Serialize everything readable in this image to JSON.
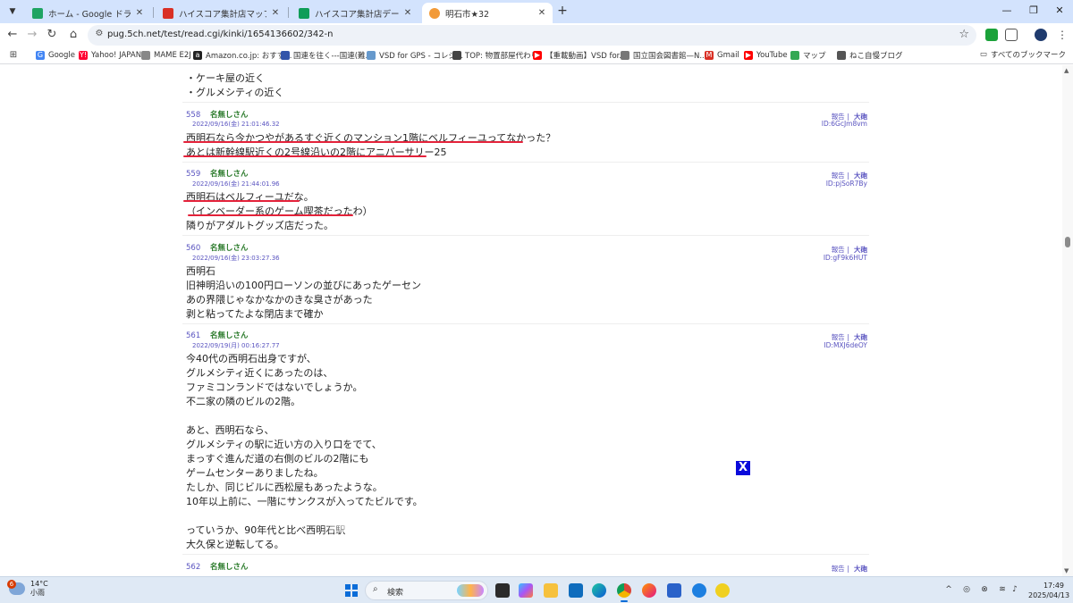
{
  "tabs": [
    {
      "label": "ホーム - Google ドライブ",
      "color": "#1fa463"
    },
    {
      "label": "ハイスコア集計店マップ（ゲーメスト）",
      "color": "#d93025"
    },
    {
      "label": "ハイスコア集計店データベース - Goo",
      "color": "#0f9d58"
    },
    {
      "label": "明石市★32",
      "color": "#f29a38",
      "active": true
    }
  ],
  "toolbar": {
    "url": "pug.5ch.net/test/read.cgi/kinki/1654136602/342-n"
  },
  "bookmarks": [
    {
      "label": "Google",
      "color": "#4285f4",
      "glyph": "G"
    },
    {
      "label": "Yahoo! JAPAN",
      "color": "#ff0033",
      "glyph": "Y!"
    },
    {
      "label": "MAME E2J",
      "color": "#888888",
      "glyph": ""
    },
    {
      "label": "Amazon.co.jp: おすす...",
      "color": "#222222",
      "glyph": "a"
    },
    {
      "label": "国連を往く---国連(難...",
      "color": "#3355aa",
      "glyph": ""
    },
    {
      "label": "VSD for GPS - コレジ...",
      "color": "#6699cc",
      "glyph": ""
    },
    {
      "label": "TOP: 物置部屋代わり",
      "color": "#444444",
      "glyph": ""
    },
    {
      "label": "【重載動画】VSD for...",
      "color": "#ff0000",
      "glyph": "▶"
    },
    {
      "label": "国立国会図書館—N...",
      "color": "#777777",
      "glyph": ""
    },
    {
      "label": "Gmail",
      "color": "#d93025",
      "glyph": "M"
    },
    {
      "label": "YouTube",
      "color": "#ff0000",
      "glyph": "▶"
    },
    {
      "label": "マップ",
      "color": "#34a853",
      "glyph": ""
    },
    {
      "label": "ねこ自慢ブログ",
      "color": "#555555",
      "glyph": ""
    }
  ],
  "bookmarks_all": "すべてのブックマーク",
  "top_lines": [
    "・ケーキ屋の近く",
    "・グルメシティの近く"
  ],
  "posts": [
    {
      "no": "558",
      "name": "名無しさん",
      "date": "2022/09/16(金) 21:01:46.32",
      "report": "報告",
      "sep": "|",
      "big": "大砲",
      "id": "ID:6GcJm8vm",
      "lines": [
        "西明石なら今かつやがあるすぐ近くのマンション1階にベルフィーユってなかった？",
        "あとは新幹線駅近くの2号線沿いの2階にアニバーサリー25"
      ]
    },
    {
      "no": "559",
      "name": "名無しさん",
      "date": "2022/09/16(金) 21:44:01.96",
      "report": "報告",
      "sep": "|",
      "big": "大砲",
      "id": "ID:pjSoR7By",
      "lines": [
        "西明石はベルフィーユだな。",
        "（インベーダー系のゲーム喫茶だったわ）",
        "隣りがアダルトグッズ店だった。"
      ]
    },
    {
      "no": "560",
      "name": "名無しさん",
      "date": "2022/09/16(金) 23:03:27.36",
      "report": "報告",
      "sep": "|",
      "big": "大砲",
      "id": "ID:gF9k6HUT",
      "lines": [
        "西明石",
        "旧神明沿いの100円ローソンの並びにあったゲーセン",
        "あの界隈じゃなかなかのきな臭さがあった",
        "剥と粘ってたよな閉店まで確か"
      ]
    },
    {
      "no": "561",
      "name": "名無しさん",
      "date": "2022/09/19(月) 00:16:27.77",
      "report": "報告",
      "sep": "|",
      "big": "大砲",
      "id": "ID:MXJ6deOY",
      "lines": [
        "今40代の西明石出身ですが、",
        "グルメシティ近くにあったのは、",
        "ファミコンランドではないでしょうか。",
        "不二家の隣のビルの2階。",
        "",
        "あと、西明石なら、",
        "グルメシティの駅に近い方の入り口をでて、",
        "まっすぐ進んだ道の右側のビルの2階にも",
        "ゲームセンターありましたね。",
        "たしか、同じビルに西松屋もあったような。",
        "10年以上前に、一階にサンクスが入ってたビルです。",
        "",
        "っていうか、90年代と比べ西明石駅",
        "大久保と逆転してる。"
      ]
    },
    {
      "no": "562",
      "name": "名無しさん",
      "date": "",
      "report": "報告",
      "sep": "|",
      "big": "大砲",
      "id": ""
    }
  ],
  "close_button": "X",
  "taskbar": {
    "weather_temp": "14°C",
    "weather_desc": "小雨",
    "weather_badge": "6",
    "search_placeholder": "検索",
    "time": "17:49",
    "date": "2025/04/13"
  }
}
